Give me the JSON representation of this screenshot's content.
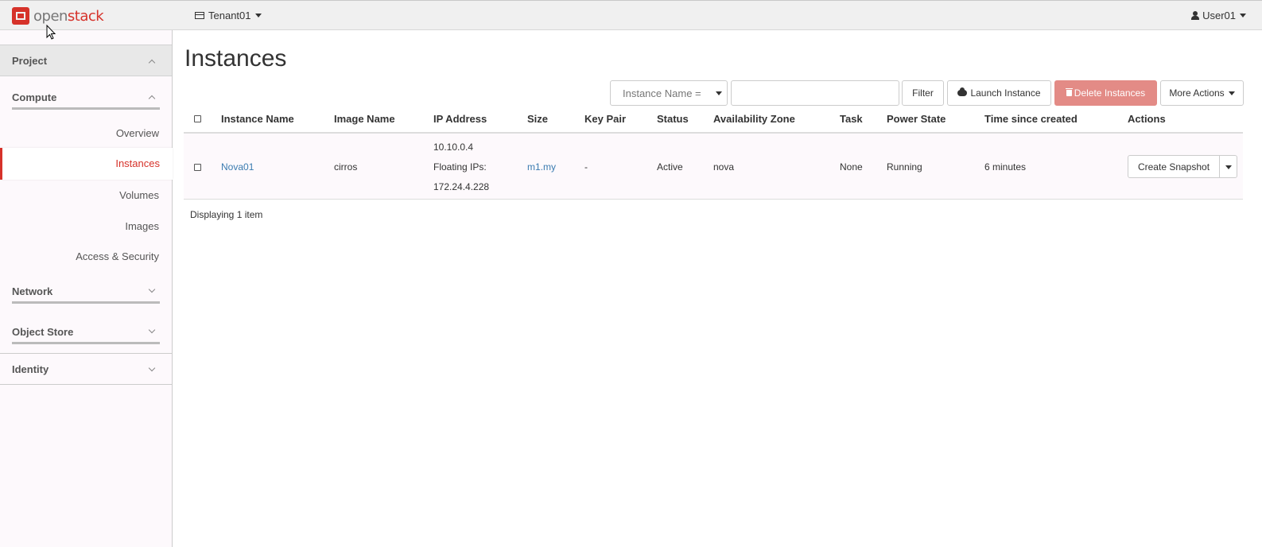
{
  "brand": {
    "open": "open",
    "stack": "stack"
  },
  "header": {
    "tenant": "Tenant01",
    "user": "User01"
  },
  "sidebar": {
    "project": "Project",
    "compute": "Compute",
    "items": [
      "Overview",
      "Instances",
      "Volumes",
      "Images",
      "Access & Security"
    ],
    "network": "Network",
    "object_store": "Object Store",
    "identity": "Identity"
  },
  "page": {
    "title": "Instances"
  },
  "toolbar": {
    "filter_field": "Instance Name =",
    "filter_value": "",
    "filter_button": "Filter",
    "launch_button": "Launch Instance",
    "delete_button": "Delete Instances",
    "more_button": "More Actions"
  },
  "table": {
    "columns": [
      "Instance Name",
      "Image Name",
      "IP Address",
      "Size",
      "Key Pair",
      "Status",
      "Availability Zone",
      "Task",
      "Power State",
      "Time since created",
      "Actions"
    ],
    "rows": [
      {
        "name": "Nova01",
        "image": "cirros",
        "ip": "10.10.0.4",
        "floating_label": "Floating IPs:",
        "floating_ip": "172.24.4.228",
        "size": "m1.my",
        "key_pair": "-",
        "status": "Active",
        "zone": "nova",
        "task": "None",
        "power": "Running",
        "time": "6 minutes",
        "action": "Create Snapshot"
      }
    ],
    "footer": "Displaying 1 item"
  },
  "colors": {
    "accent": "#d6322a",
    "link": "#3a7bb0",
    "danger_btn": "#e38b86"
  },
  "icons": [
    "openstack-logo-icon",
    "table-icon",
    "user-icon",
    "cloud-upload-icon",
    "trash-icon",
    "caret-down-icon",
    "chevron-up-icon",
    "chevron-down-icon",
    "mouse-cursor-icon"
  ]
}
